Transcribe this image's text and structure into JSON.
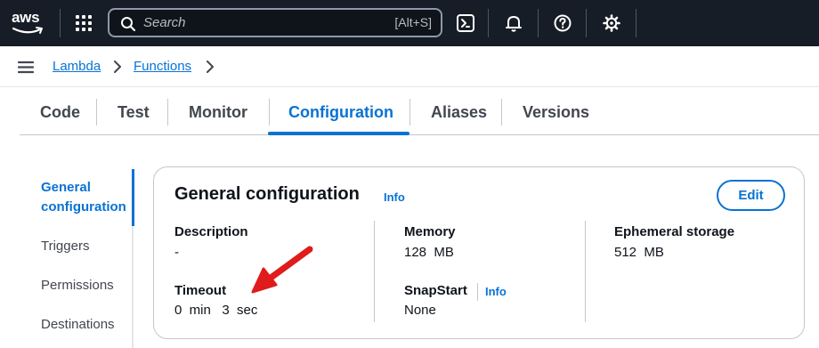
{
  "topnav": {
    "logo_text": "aws",
    "search_placeholder": "Search",
    "search_shortcut": "[Alt+S]",
    "icons": [
      "apps-grid-icon",
      "cloudshell-icon",
      "notifications-bell-icon",
      "help-icon",
      "settings-gear-icon"
    ]
  },
  "breadcrumb": {
    "items": [
      "Lambda",
      "Functions"
    ]
  },
  "tabs": [
    {
      "label": "Code"
    },
    {
      "label": "Test"
    },
    {
      "label": "Monitor"
    },
    {
      "label": "Configuration",
      "active": true
    },
    {
      "label": "Aliases"
    },
    {
      "label": "Versions"
    }
  ],
  "sidenav": {
    "items": [
      {
        "label": "General configuration",
        "line1": "General",
        "line2": "configuration",
        "active": true
      },
      {
        "label": "Triggers"
      },
      {
        "label": "Permissions"
      },
      {
        "label": "Destinations"
      }
    ]
  },
  "card": {
    "title": "General configuration",
    "info_label": "Info",
    "edit_label": "Edit",
    "description": {
      "label": "Description",
      "value": "-"
    },
    "memory": {
      "label": "Memory",
      "value": "128  MB"
    },
    "ephemeral_storage": {
      "label": "Ephemeral storage",
      "value": "512  MB"
    },
    "timeout": {
      "label": "Timeout",
      "value": "0  min   3  sec"
    },
    "snapstart": {
      "label": "SnapStart",
      "info_label": "Info",
      "value": "None"
    }
  },
  "colors": {
    "nav_bg": "#161d26",
    "link_blue": "#0972d3",
    "annotation_red": "#e01b1b"
  }
}
